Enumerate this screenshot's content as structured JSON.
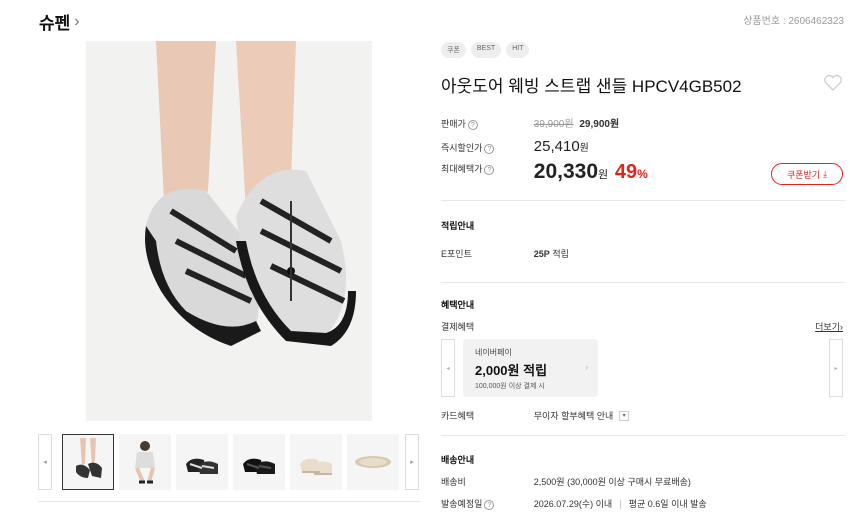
{
  "header": {
    "brand": "슈펜",
    "product_number": "상품번호 : 2606462323"
  },
  "badges": [
    "쿠폰",
    "BEST",
    "HIT"
  ],
  "product": {
    "title": "아웃도어 웨빙 스트랩 샌들 HPCV4GB502"
  },
  "price": {
    "sale_label": "판매가",
    "original": "39,900원",
    "sale": "29,900원",
    "instant_label": "즉시할인가",
    "instant_value": "25,410",
    "instant_unit": "원",
    "max_label": "최대혜택가",
    "max_value": "20,330",
    "max_unit": "원",
    "rate_value": "49",
    "rate_unit": "%",
    "coupon_button": "쿠폰받기"
  },
  "points": {
    "section_title": "적립안내",
    "label": "E포인트",
    "value": "25P",
    "value_suffix": "적립"
  },
  "benefits": {
    "section_title": "혜택안내",
    "payment_label": "결제혜택",
    "more_link": "더보기",
    "card": {
      "name": "네이버페이",
      "amount": "2,000원 적립",
      "condition": "100,000원 이상 결제 시"
    },
    "card_label": "카드혜택",
    "card_value": "무이자 할부혜택 안내"
  },
  "shipping": {
    "section_title": "배송안내",
    "fee_label": "배송비",
    "fee_value": "2,500원 (30,000원 이상 구매시 무료배송)",
    "date_label": "발송예정일",
    "date_value": "2026.07.29(수) 이내",
    "avg_value": "평균 0.6일 이내 발송"
  },
  "icons": {
    "question": "?",
    "chevron_right": "›",
    "arrow_left": "◂",
    "arrow_right": "▸",
    "download": "⤓",
    "dropdown": "▾"
  },
  "colors": {
    "accent_red": "#e1231c",
    "text_dark": "#111111",
    "muted": "#999999"
  }
}
